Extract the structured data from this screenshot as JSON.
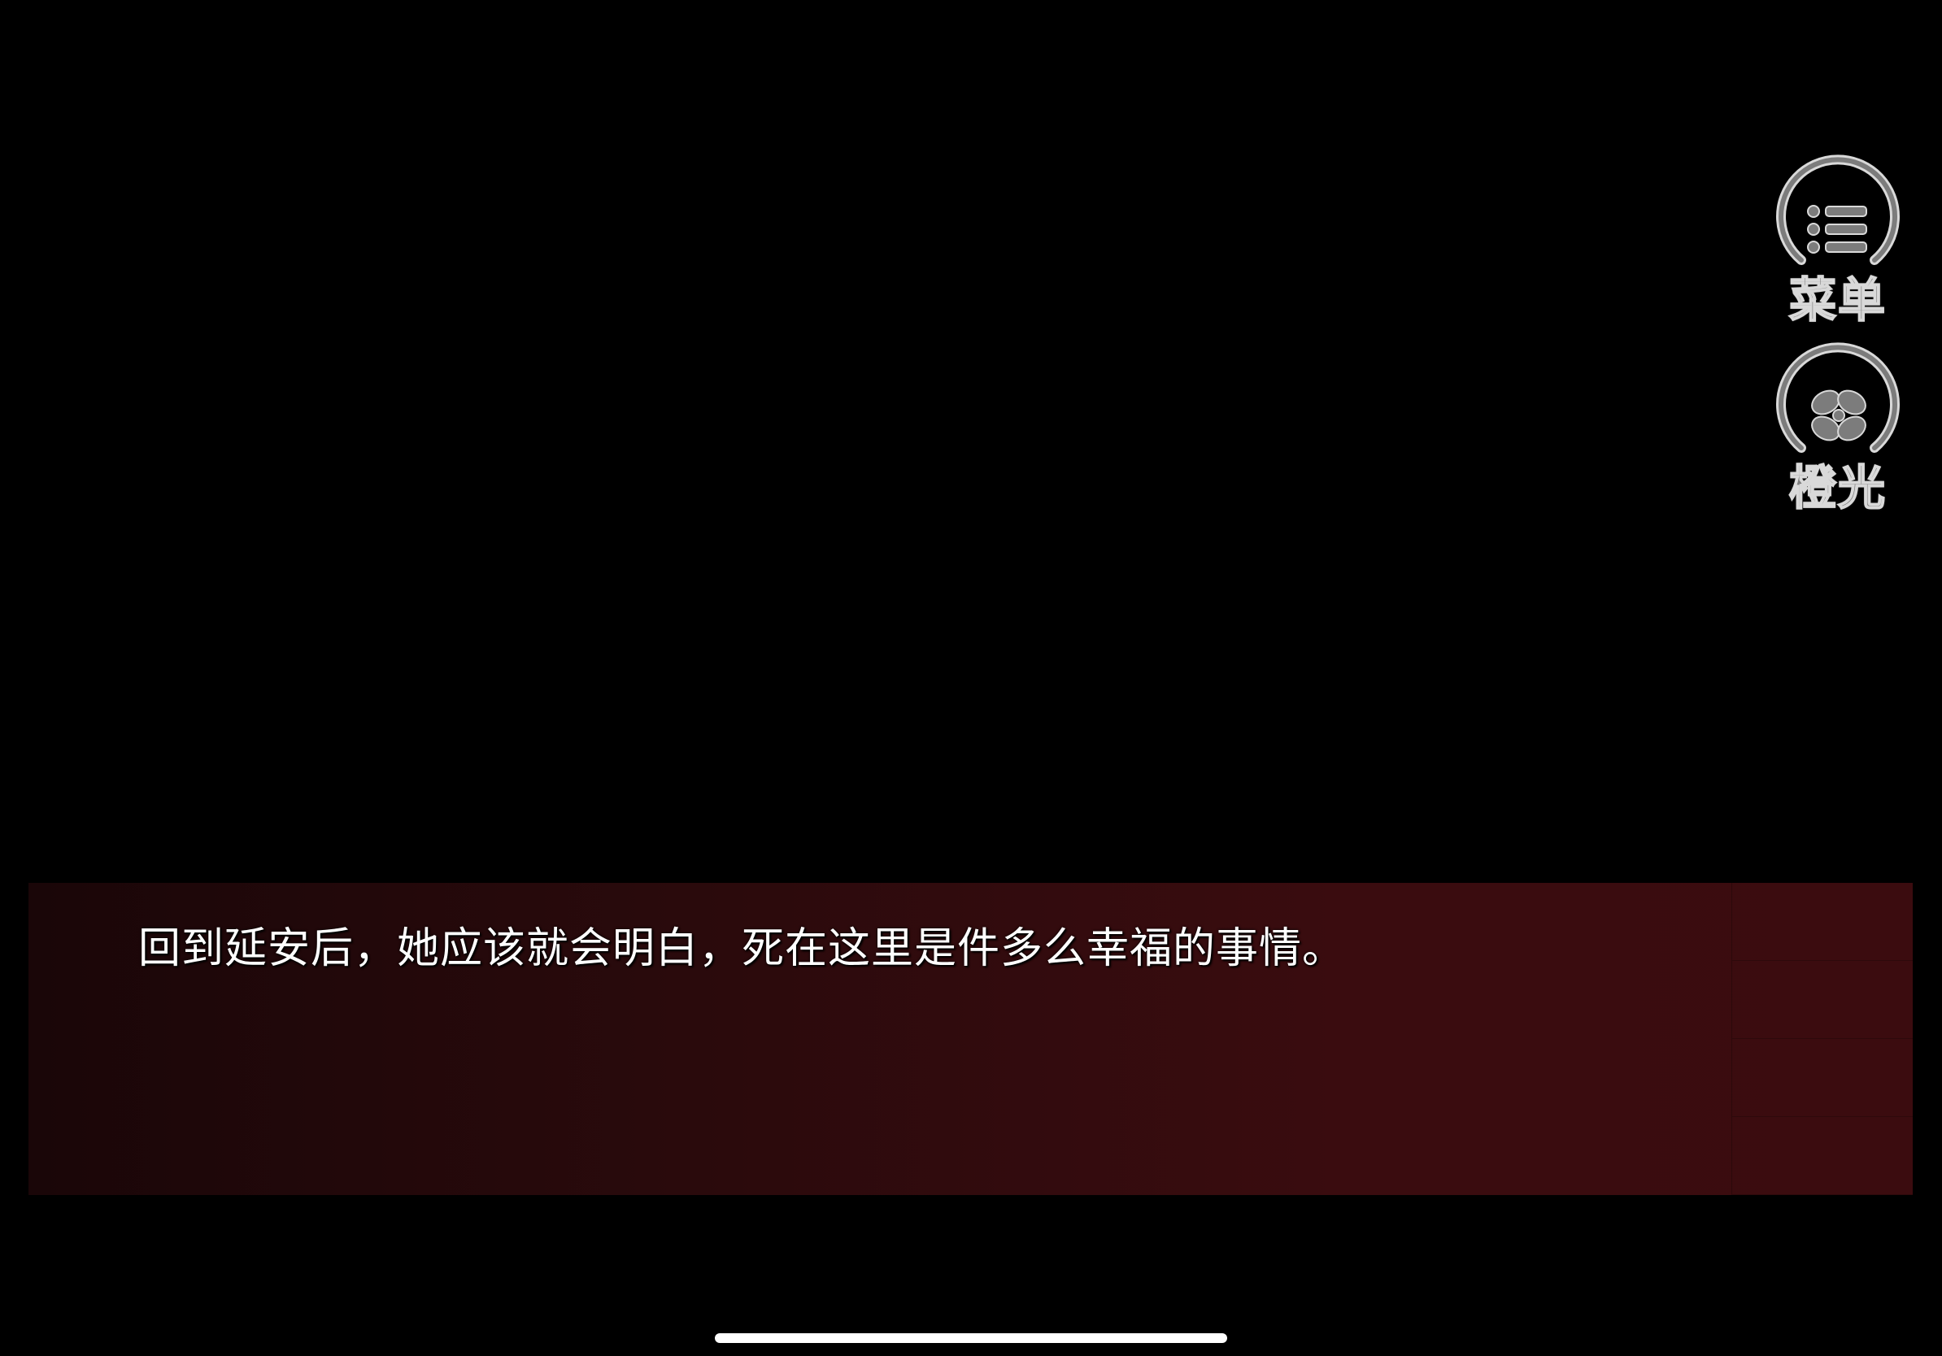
{
  "scene": {
    "background_color": "#000000"
  },
  "side_buttons": {
    "menu": {
      "label": "菜单",
      "icon": "list-icon"
    },
    "light": {
      "label": "橙光",
      "icon": "orange-light-logo-icon"
    }
  },
  "dialogue": {
    "text": "回到延安后，她应该就会明白，死在这里是件多么幸福的事情。",
    "box_color_start": "#1a0608",
    "box_color_end": "#3b0c0f"
  },
  "colors": {
    "button_fill": "#7c7c7c",
    "button_outline": "#d9d9d9",
    "text": "#ffffff"
  }
}
